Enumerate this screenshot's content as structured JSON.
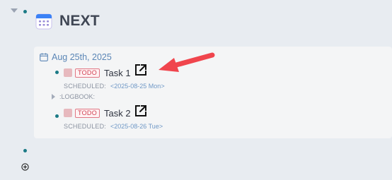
{
  "page": {
    "title": "NEXT",
    "title_icon": "calendar-icon"
  },
  "query": {
    "date_header": "Aug 25th, 2025",
    "tasks": [
      {
        "marker": "TODO",
        "label": "Task 1",
        "scheduled_label": "SCHEDULED:",
        "scheduled_date": "<2025-08-25 Mon>"
      },
      {
        "marker": "TODO",
        "label": "Task 2",
        "scheduled_label": "SCHEDULED:",
        "scheduled_date": "<2025-08-26 Tue>"
      }
    ],
    "logbook_label": ":LOGBOOK:"
  },
  "colors": {
    "background": "#e8ecf1",
    "panel": "#f4f5f6",
    "bullet": "#1b7a86",
    "todo": "#d03e50",
    "link": "#5b86b6",
    "annotation_arrow": "#f0454d"
  },
  "icons": {
    "external_link": "external-link-icon",
    "add_block": "plus-circle-icon",
    "annotation": "red-arrow-icon"
  }
}
